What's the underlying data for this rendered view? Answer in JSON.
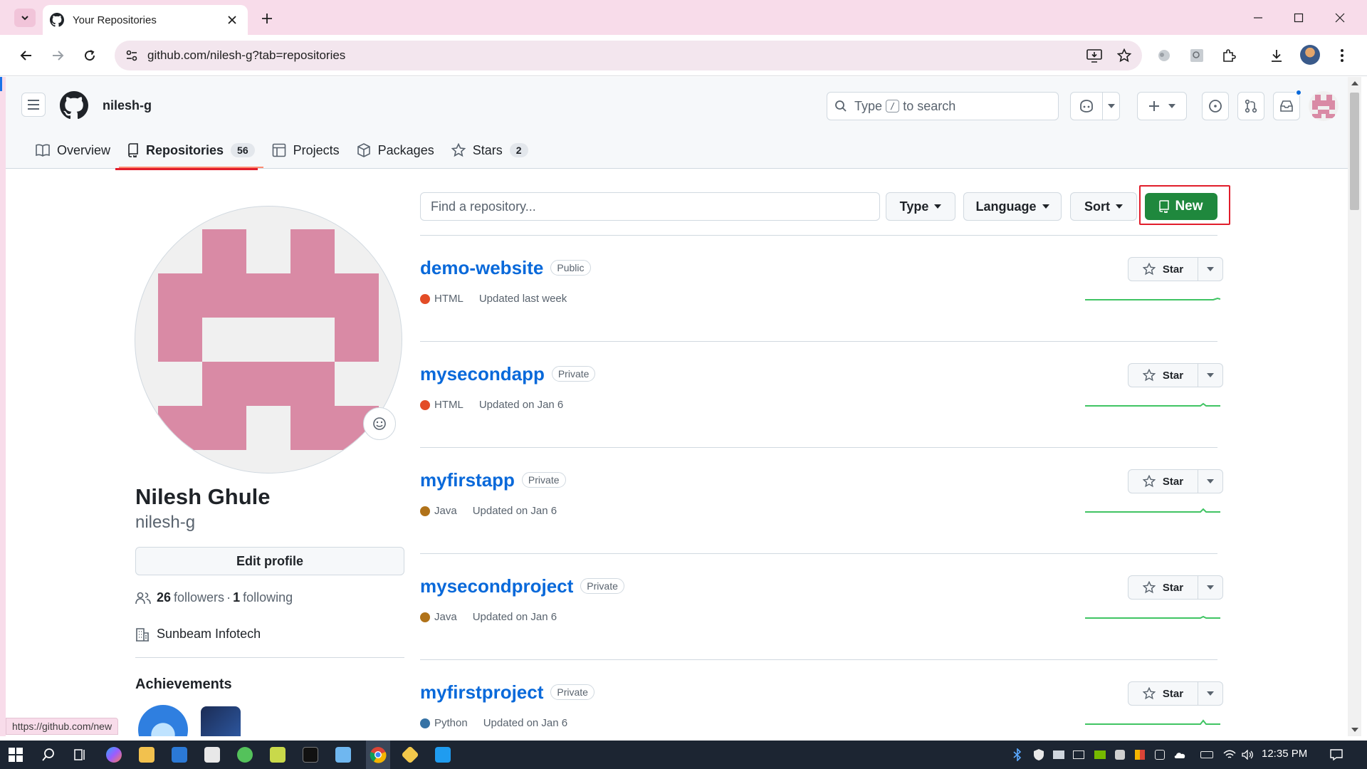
{
  "browser": {
    "tab_title": "Your Repositories",
    "url": "github.com/nilesh-g?tab=repositories",
    "status_url": "https://github.com/new"
  },
  "header": {
    "username": "nilesh-g",
    "search_prefix": "Type",
    "search_key": "/",
    "search_suffix": "to search"
  },
  "tabs": [
    {
      "label": "Overview"
    },
    {
      "label": "Repositories",
      "count": "56"
    },
    {
      "label": "Projects"
    },
    {
      "label": "Packages"
    },
    {
      "label": "Stars",
      "count": "2"
    }
  ],
  "profile": {
    "full_name": "Nilesh Ghule",
    "login": "nilesh-g",
    "edit_label": "Edit profile",
    "followers_count": "26",
    "followers_label": "followers",
    "separator": "·",
    "following_count": "1",
    "following_label": "following",
    "organization": "Sunbeam Infotech",
    "achievements_title": "Achievements"
  },
  "repo_toolbar": {
    "find_placeholder": "Find a repository...",
    "type_label": "Type",
    "language_label": "Language",
    "sort_label": "Sort",
    "new_label": "New"
  },
  "repos": [
    {
      "name": "demo-website",
      "visibility": "Public",
      "language": "HTML",
      "lang_color": "#e34c26",
      "updated": "Updated last week",
      "star_label": "Star"
    },
    {
      "name": "mysecondapp",
      "visibility": "Private",
      "language": "HTML",
      "lang_color": "#e34c26",
      "updated": "Updated on Jan 6",
      "star_label": "Star"
    },
    {
      "name": "myfirstapp",
      "visibility": "Private",
      "language": "Java",
      "lang_color": "#b07219",
      "updated": "Updated on Jan 6",
      "star_label": "Star"
    },
    {
      "name": "mysecondproject",
      "visibility": "Private",
      "language": "Java",
      "lang_color": "#b07219",
      "updated": "Updated on Jan 6",
      "star_label": "Star"
    },
    {
      "name": "myfirstproject",
      "visibility": "Private",
      "language": "Python",
      "lang_color": "#3572A5",
      "updated": "Updated on Jan 6",
      "star_label": "Star"
    }
  ],
  "taskbar": {
    "time": "12:35 PM"
  },
  "colors": {
    "accent_green": "#1f883d",
    "link_blue": "#0969da",
    "identicon_pink": "#d98aa5",
    "highlight_red": "#e11d2b"
  }
}
